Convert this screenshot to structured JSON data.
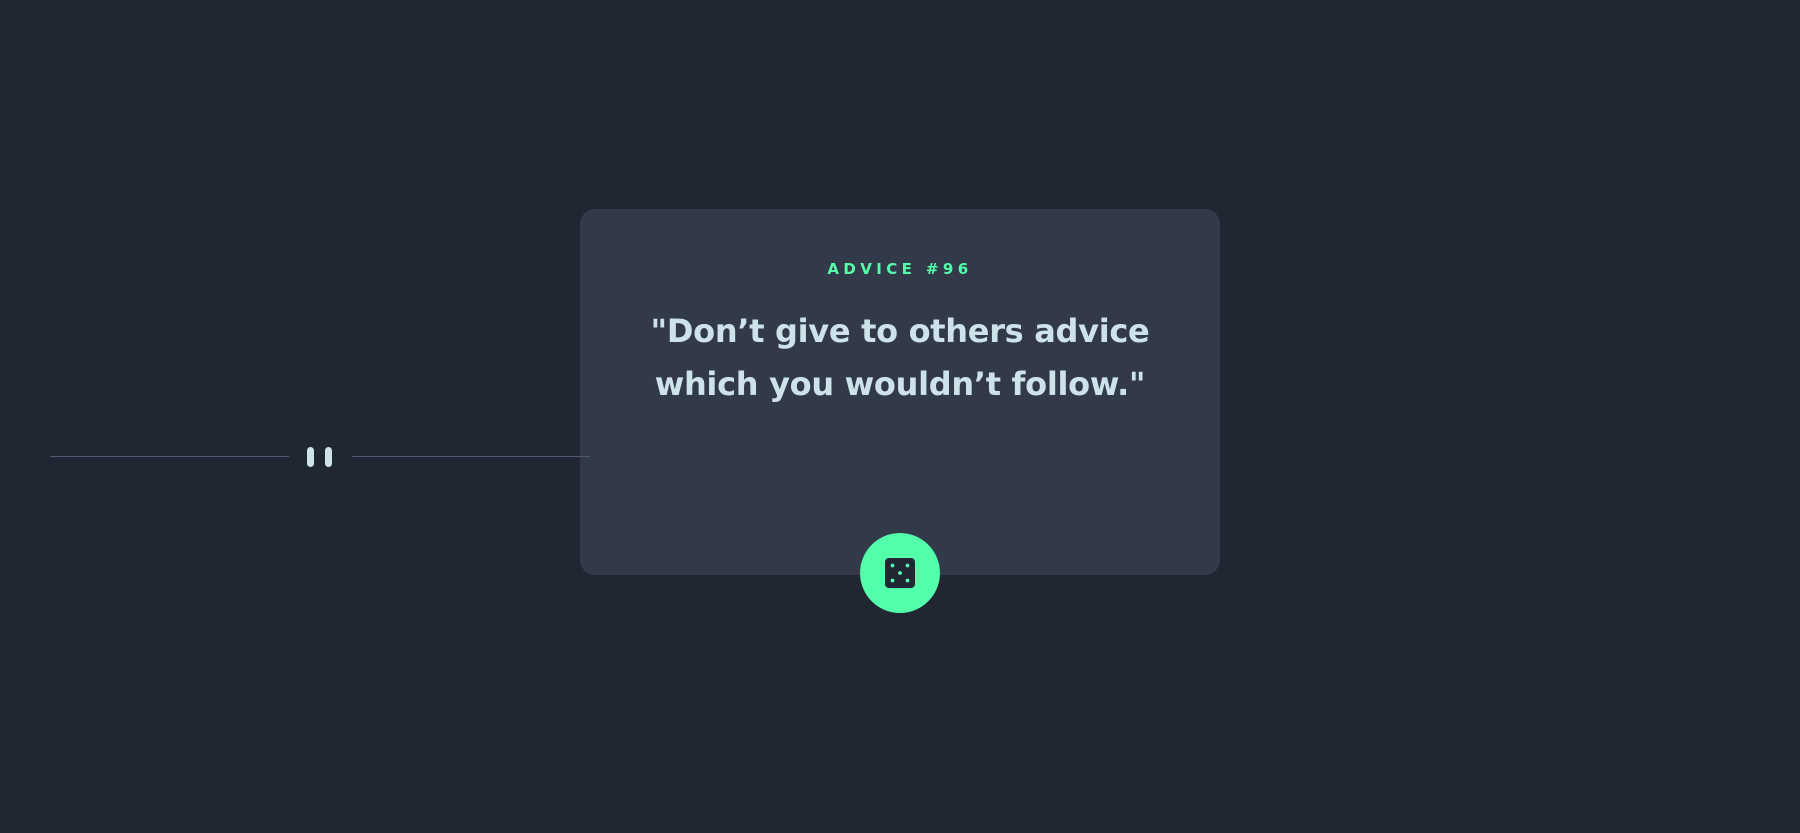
{
  "advice": {
    "label": "ADVICE #96",
    "quote": "\"Don’t give to others advice which you wouldn’t follow.\""
  },
  "divider": {
    "icon": "pause-icon"
  },
  "dice_button": {
    "icon": "dice-icon",
    "accent_color": "#53ffaa"
  },
  "colors": {
    "background": "#202632",
    "card": "#323a49",
    "accent": "#53ffaa",
    "text": "#cee3e9",
    "divider": "#4f5d74"
  }
}
